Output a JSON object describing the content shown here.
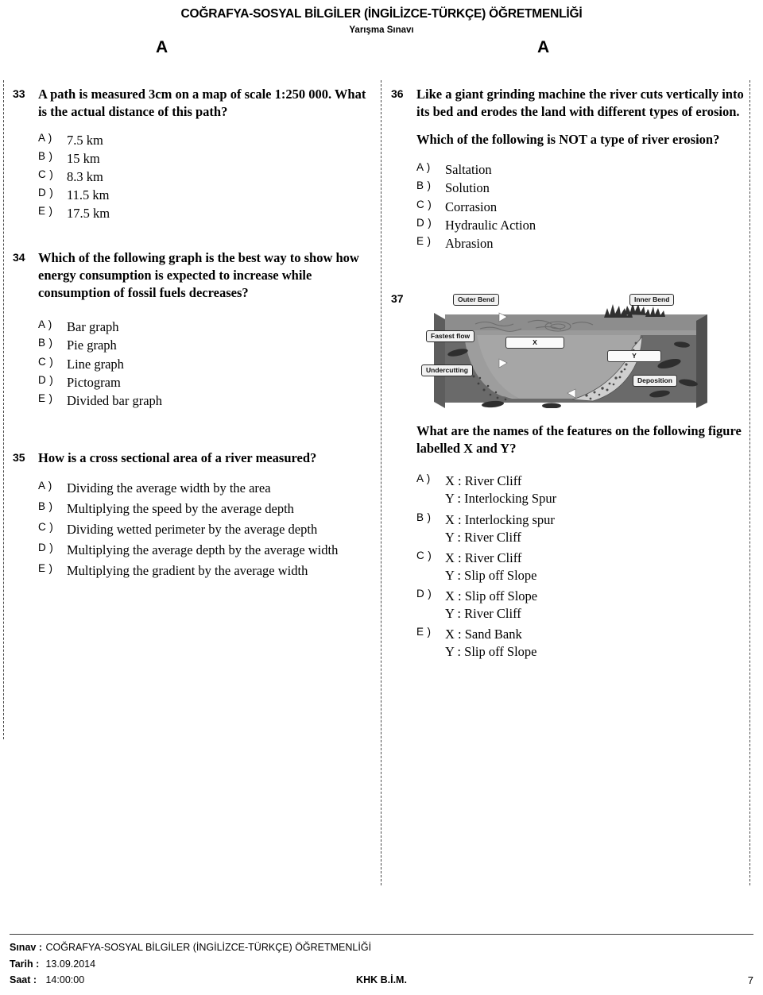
{
  "header": {
    "title": "COĞRAFYA-SOSYAL BİLGİLER (İNGİLİZCE-TÜRKÇE) ÖĞRETMENLİĞİ",
    "subtitle": "Yarışma Sınavı",
    "booklet_left": "A",
    "booklet_right": "A"
  },
  "left_column": {
    "q33": {
      "number": "33",
      "stem": "A path is measured 3cm on a map of scale 1:250 000. What is the actual distance of this path?",
      "options": [
        {
          "key": "A )",
          "text": "7.5 km"
        },
        {
          "key": "B )",
          "text": "15 km"
        },
        {
          "key": "C )",
          "text": "8.3 km"
        },
        {
          "key": "D )",
          "text": "11.5 km"
        },
        {
          "key": "E )",
          "text": "17.5 km"
        }
      ]
    },
    "q34": {
      "number": "34",
      "stem": "Which of the following graph is the best way to show how energy consumption is expected to increase while consumption of fossil fuels decreases?",
      "options": [
        {
          "key": "A )",
          "text": "Bar graph"
        },
        {
          "key": "B )",
          "text": "Pie graph"
        },
        {
          "key": "C )",
          "text": "Line graph"
        },
        {
          "key": "D )",
          "text": "Pictogram"
        },
        {
          "key": "E )",
          "text": "Divided bar graph"
        }
      ]
    },
    "q35": {
      "number": "35",
      "stem": "How is a cross sectional area of a river measured?",
      "options": [
        {
          "key": "A )",
          "text": "Dividing the average width by the area"
        },
        {
          "key": "B )",
          "text": "Multiplying the speed by the average depth"
        },
        {
          "key": "C )",
          "text": "Dividing wetted perimeter by the average depth"
        },
        {
          "key": "D )",
          "text": "Multiplying the average depth by the average width"
        },
        {
          "key": "E )",
          "text": "Multiplying the gradient by the average width"
        }
      ]
    }
  },
  "right_column": {
    "q36": {
      "number": "36",
      "stem1": "Like a giant grinding machine the river cuts vertically into its bed and erodes the land with different types of erosion.",
      "stem2": "Which of the following is NOT a type of river erosion?",
      "options": [
        {
          "key": "A )",
          "text": "Saltation"
        },
        {
          "key": "B )",
          "text": "Solution"
        },
        {
          "key": "C )",
          "text": "Corrasion"
        },
        {
          "key": "D )",
          "text": "Hydraulic Action"
        },
        {
          "key": "E )",
          "text": "Abrasion"
        }
      ]
    },
    "q37": {
      "number": "37",
      "figure": {
        "caption": "river meander cross-section diagram",
        "labels": {
          "outer_bend": "Outer Bend",
          "inner_bend": "Inner Bend",
          "fastest_flow": "Fastest flow",
          "undercutting": "Undercutting",
          "deposition": "Deposition",
          "marker_x": "X",
          "marker_y": "Y"
        }
      },
      "stem": "What are the names of the features on the following figure labelled X and Y?",
      "options": [
        {
          "key": "A )",
          "line1": "X : River Cliff",
          "line2": "Y : Interlocking Spur"
        },
        {
          "key": "B )",
          "line1": "X : Interlocking spur",
          "line2": "Y : River Cliff"
        },
        {
          "key": "C )",
          "line1": "X : River Cliff",
          "line2": "Y : Slip off Slope"
        },
        {
          "key": "D )",
          "line1": "X : Slip off Slope",
          "line2": "Y : River Cliff"
        },
        {
          "key": "E )",
          "line1": "X : Sand Bank",
          "line2": "Y : Slip off Slope"
        }
      ]
    }
  },
  "footer": {
    "exam_key": "Sınav :",
    "exam_value": "COĞRAFYA-SOSYAL BİLGİLER (İNGİLİZCE-TÜRKÇE) ÖĞRETMENLİĞİ",
    "date_key": "Tarih :",
    "date_value": "13.09.2014",
    "time_key": "Saat :",
    "time_value": "14:00:00",
    "center": "KHK B.İ.M.",
    "page": "7"
  }
}
